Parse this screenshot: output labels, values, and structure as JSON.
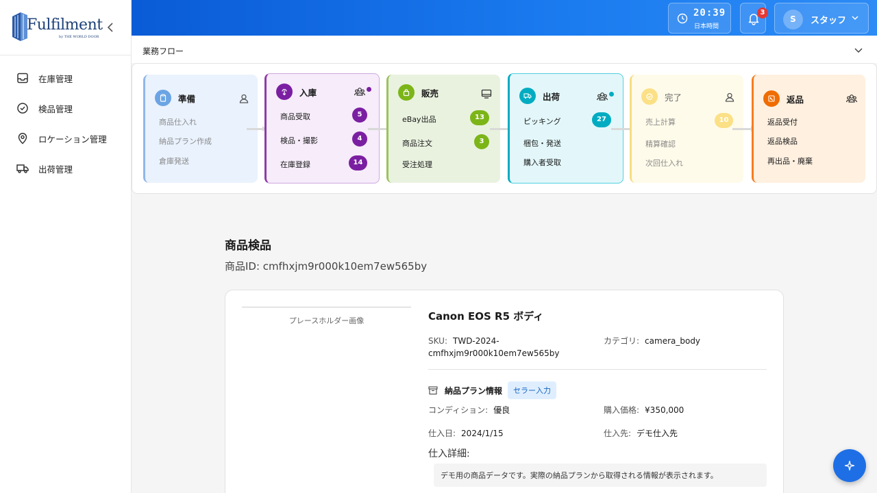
{
  "app": {
    "logo_text": "Fulfilment",
    "logo_sub": "by THE WORLD DOOR"
  },
  "sidebar": {
    "items": [
      {
        "label": "在庫管理",
        "icon": "inbox-icon"
      },
      {
        "label": "検品管理",
        "icon": "check-circle-icon"
      },
      {
        "label": "ロケーション管理",
        "icon": "map-pin-icon"
      },
      {
        "label": "出荷管理",
        "icon": "truck-icon"
      }
    ]
  },
  "header": {
    "time": "20:39",
    "timezone": "日本時間",
    "notification_count": "3",
    "avatar_initial": "S",
    "user_name": "スタッフ"
  },
  "workflow": {
    "title": "業務フロー",
    "stages": [
      {
        "title": "準備",
        "color": "#5b9be0",
        "rows": [
          "商品仕入れ",
          "納品プラン作成",
          "倉庫発送"
        ]
      },
      {
        "title": "入庫",
        "color": "#7b1fa2",
        "rows": [
          "商品受取",
          "検品・撮影",
          "在庫登録"
        ],
        "counts": [
          "5",
          "4",
          "14"
        ]
      },
      {
        "title": "販売",
        "color": "#7cb518",
        "rows": [
          "eBay出品",
          "商品注文",
          "受注処理"
        ],
        "counts": [
          "13",
          "3"
        ]
      },
      {
        "title": "出荷",
        "color": "#00acc1",
        "rows": [
          "ピッキング",
          "梱包・発送",
          "購入者受取"
        ],
        "counts": [
          "27"
        ]
      },
      {
        "title": "完了",
        "color": "#f9d44a",
        "rows": [
          "売上計算",
          "精算確認",
          "次回仕入れ"
        ],
        "counts": [
          "10"
        ]
      },
      {
        "title": "返品",
        "color": "#ef6c00",
        "rows": [
          "返品受付",
          "返品検品",
          "再出品・廃棄"
        ]
      }
    ]
  },
  "main": {
    "title": "商品検品",
    "product_id_label": "商品ID: cmfhxjm9r000k10em7ew565by",
    "placeholder": "プレースホルダー画像",
    "product_name": "Canon EOS R5 ボディ",
    "sku_label": "SKU:",
    "sku_value_1": "TWD-2024-",
    "sku_value_2": "cmfhxjm9r000k10em7ew565by",
    "category_label": "カテゴリ:",
    "category_value": "camera_body",
    "plan_title": "納品プラン情報",
    "seller_tag": "セラー入力",
    "condition_label": "コンディション:",
    "condition_value": "優良",
    "price_label": "購入価格:",
    "price_value": "¥350,000",
    "date_label": "仕入日:",
    "date_value": "2024/1/15",
    "supplier_label": "仕入先:",
    "supplier_value": "デモ仕入先",
    "detail_title": "仕入詳細:",
    "detail_text": "デモ用の商品データです。実際の納品プランから取得される情報が表示されます。"
  }
}
